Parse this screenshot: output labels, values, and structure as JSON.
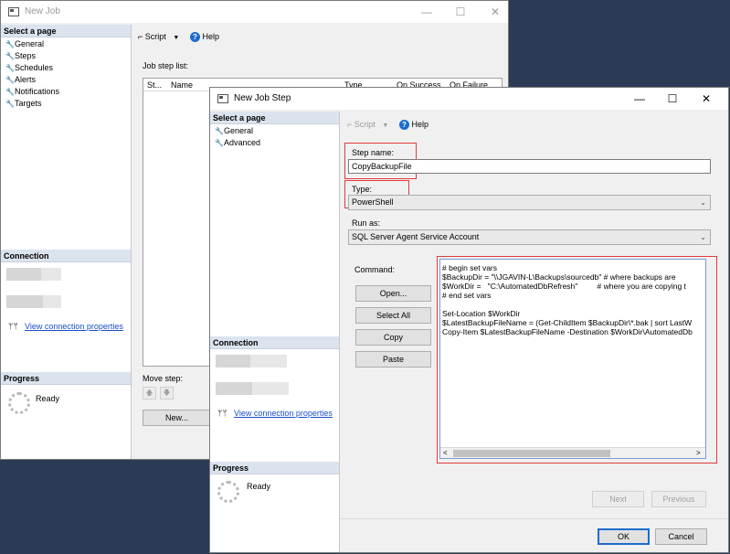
{
  "back_window": {
    "title": "New Job",
    "controls": {
      "minimize": "—",
      "maximize": "☐",
      "close": "✕"
    },
    "select_page_header": "Select a page",
    "pages": [
      {
        "label": "General"
      },
      {
        "label": "Steps"
      },
      {
        "label": "Schedules"
      },
      {
        "label": "Alerts"
      },
      {
        "label": "Notifications"
      },
      {
        "label": "Targets"
      }
    ],
    "toolbar": {
      "script_label": "Script",
      "help_label": "Help"
    },
    "job_step_list_label": "Job step list:",
    "columns": [
      "St...",
      "Name",
      "Type",
      "On Success",
      "On Failure"
    ],
    "connection_header": "Connection",
    "view_connection_properties": "View connection properties",
    "progress_header": "Progress",
    "progress_status": "Ready",
    "move_step_label": "Move step:",
    "new_button": "New..."
  },
  "front_window": {
    "title": "New Job Step",
    "controls": {
      "minimize": "—",
      "maximize": "☐",
      "close": "✕"
    },
    "select_page_header": "Select a page",
    "pages": [
      {
        "label": "General"
      },
      {
        "label": "Advanced"
      }
    ],
    "toolbar": {
      "script_label": "Script",
      "help_label": "Help"
    },
    "step_name_label": "Step name:",
    "step_name_value": "CopyBackupFile",
    "type_label": "Type:",
    "type_value": "PowerShell",
    "run_as_label": "Run as:",
    "run_as_value": "SQL Server Agent Service Account",
    "command_label": "Command:",
    "command_buttons": {
      "open": "Open...",
      "select_all": "Select All",
      "copy": "Copy",
      "paste": "Paste"
    },
    "command_lines": [
      "# begin set vars",
      "$BackupDir = \"\\\\JGAVIN-L\\Backups\\sourcedb\" # where backups are",
      "$WorkDir =   \"C:\\AutomatedDbRefresh\"         # where you are copying t",
      "# end set vars",
      "",
      "Set-Location $WorkDir",
      "$LatestBackupFileName = (Get-ChildItem $BackupDir\\*.bak | sort LastW",
      "Copy-Item $LatestBackupFileName -Destination $WorkDir\\AutomatedDb"
    ],
    "connection_header": "Connection",
    "view_connection_properties": "View connection properties",
    "progress_header": "Progress",
    "progress_status": "Ready",
    "next_button": "Next",
    "previous_button": "Previous",
    "ok_button": "OK",
    "cancel_button": "Cancel"
  }
}
